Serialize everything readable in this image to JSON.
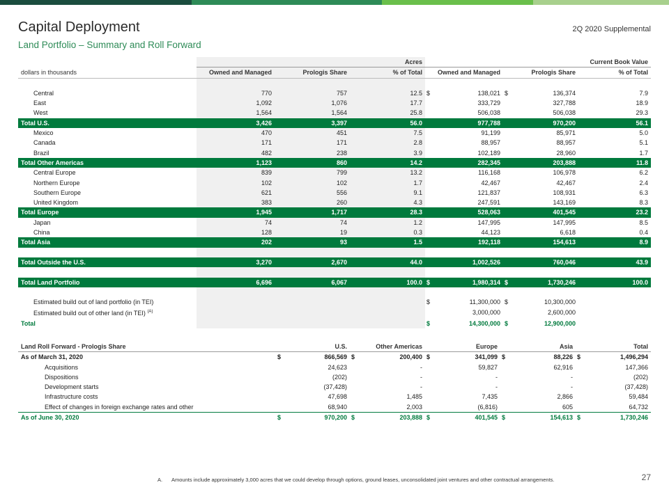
{
  "header": {
    "title": "Capital Deployment",
    "subtitle": "Land Portfolio – Summary and Roll Forward",
    "supplemental": "2Q 2020 Supplemental"
  },
  "colors": {
    "accent_green": "#007a3d",
    "topbar": [
      "#1b4d3e",
      "#2e8b57",
      "#6abf4b",
      "#a8d08d"
    ]
  },
  "summary": {
    "group_headers": {
      "acres": "Acres",
      "book_value": "Current Book Value"
    },
    "columns": [
      "dollars in thousands",
      "Owned and Managed",
      "Prologis Share",
      "% of Total",
      "Owned and Managed",
      "Prologis Share",
      "% of Total"
    ],
    "rows": [
      {
        "label": "Central",
        "type": "item",
        "ac_om": "770",
        "ac_ps": "757",
        "ac_pct": "12.5",
        "d1": "$",
        "bv_om": "138,021",
        "d2": "$",
        "bv_ps": "136,374",
        "bv_pct": "7.9"
      },
      {
        "label": "East",
        "type": "item",
        "ac_om": "1,092",
        "ac_ps": "1,076",
        "ac_pct": "17.7",
        "d1": "",
        "bv_om": "333,729",
        "d2": "",
        "bv_ps": "327,788",
        "bv_pct": "18.9"
      },
      {
        "label": "West",
        "type": "item",
        "ac_om": "1,564",
        "ac_ps": "1,564",
        "ac_pct": "25.8",
        "d1": "",
        "bv_om": "506,038",
        "d2": "",
        "bv_ps": "506,038",
        "bv_pct": "29.3"
      },
      {
        "label": "Total U.S.",
        "type": "total",
        "ac_om": "3,426",
        "ac_ps": "3,397",
        "ac_pct": "56.0",
        "d1": "",
        "bv_om": "977,788",
        "d2": "",
        "bv_ps": "970,200",
        "bv_pct": "56.1"
      },
      {
        "label": "Mexico",
        "type": "item",
        "ac_om": "470",
        "ac_ps": "451",
        "ac_pct": "7.5",
        "d1": "",
        "bv_om": "91,199",
        "d2": "",
        "bv_ps": "85,971",
        "bv_pct": "5.0"
      },
      {
        "label": "Canada",
        "type": "item",
        "ac_om": "171",
        "ac_ps": "171",
        "ac_pct": "2.8",
        "d1": "",
        "bv_om": "88,957",
        "d2": "",
        "bv_ps": "88,957",
        "bv_pct": "5.1"
      },
      {
        "label": "Brazil",
        "type": "item",
        "ac_om": "482",
        "ac_ps": "238",
        "ac_pct": "3.9",
        "d1": "",
        "bv_om": "102,189",
        "d2": "",
        "bv_ps": "28,960",
        "bv_pct": "1.7"
      },
      {
        "label": "Total Other Americas",
        "type": "total",
        "ac_om": "1,123",
        "ac_ps": "860",
        "ac_pct": "14.2",
        "d1": "",
        "bv_om": "282,345",
        "d2": "",
        "bv_ps": "203,888",
        "bv_pct": "11.8"
      },
      {
        "label": "Central Europe",
        "type": "item",
        "ac_om": "839",
        "ac_ps": "799",
        "ac_pct": "13.2",
        "d1": "",
        "bv_om": "116,168",
        "d2": "",
        "bv_ps": "106,978",
        "bv_pct": "6.2"
      },
      {
        "label": "Northern Europe",
        "type": "item",
        "ac_om": "102",
        "ac_ps": "102",
        "ac_pct": "1.7",
        "d1": "",
        "bv_om": "42,467",
        "d2": "",
        "bv_ps": "42,467",
        "bv_pct": "2.4"
      },
      {
        "label": "Southern Europe",
        "type": "item",
        "ac_om": "621",
        "ac_ps": "556",
        "ac_pct": "9.1",
        "d1": "",
        "bv_om": "121,837",
        "d2": "",
        "bv_ps": "108,931",
        "bv_pct": "6.3"
      },
      {
        "label": "United Kingdom",
        "type": "item",
        "ac_om": "383",
        "ac_ps": "260",
        "ac_pct": "4.3",
        "d1": "",
        "bv_om": "247,591",
        "d2": "",
        "bv_ps": "143,169",
        "bv_pct": "8.3"
      },
      {
        "label": "Total Europe",
        "type": "total",
        "ac_om": "1,945",
        "ac_ps": "1,717",
        "ac_pct": "28.3",
        "d1": "",
        "bv_om": "528,063",
        "d2": "",
        "bv_ps": "401,545",
        "bv_pct": "23.2"
      },
      {
        "label": "Japan",
        "type": "item",
        "ac_om": "74",
        "ac_ps": "74",
        "ac_pct": "1.2",
        "d1": "",
        "bv_om": "147,995",
        "d2": "",
        "bv_ps": "147,995",
        "bv_pct": "8.5"
      },
      {
        "label": "China",
        "type": "item",
        "ac_om": "128",
        "ac_ps": "19",
        "ac_pct": "0.3",
        "d1": "",
        "bv_om": "44,123",
        "d2": "",
        "bv_ps": "6,618",
        "bv_pct": "0.4"
      },
      {
        "label": "Total Asia",
        "type": "total",
        "ac_om": "202",
        "ac_ps": "93",
        "ac_pct": "1.5",
        "d1": "",
        "bv_om": "192,118",
        "d2": "",
        "bv_ps": "154,613",
        "bv_pct": "8.9"
      },
      {
        "label": "",
        "type": "spacer"
      },
      {
        "label": "Total Outside the U.S.",
        "type": "total",
        "ac_om": "3,270",
        "ac_ps": "2,670",
        "ac_pct": "44.0",
        "d1": "",
        "bv_om": "1,002,526",
        "d2": "",
        "bv_ps": "760,046",
        "bv_pct": "43.9"
      },
      {
        "label": "",
        "type": "spacer"
      },
      {
        "label": "Total Land Portfolio",
        "type": "total",
        "ac_om": "6,696",
        "ac_ps": "6,067",
        "ac_pct": "100.0",
        "d1": "$",
        "bv_om": "1,980,314",
        "d2": "$",
        "bv_ps": "1,730,246",
        "bv_pct": "100.0"
      },
      {
        "label": "",
        "type": "spacer"
      },
      {
        "label": "Estimated build out of land portfolio (in TEI)",
        "type": "item",
        "sup": "",
        "ac_om": "",
        "ac_ps": "",
        "ac_pct": "",
        "d1": "$",
        "bv_om": "11,300,000",
        "d2": "$",
        "bv_ps": "10,300,000",
        "bv_pct": ""
      },
      {
        "label": "Estimated build out of other land (in TEI)",
        "type": "item",
        "sup": "(A)",
        "ac_om": "",
        "ac_ps": "",
        "ac_pct": "",
        "d1": "",
        "bv_om": "3,000,000",
        "d2": "",
        "bv_ps": "2,600,000",
        "bv_pct": ""
      },
      {
        "label": "Total",
        "type": "gtotal",
        "ac_om": "",
        "ac_ps": "",
        "ac_pct": "",
        "d1": "$",
        "bv_om": "14,300,000",
        "d2": "$",
        "bv_ps": "12,900,000",
        "bv_pct": ""
      }
    ]
  },
  "roll_forward": {
    "columns": [
      "Land Roll Forward - Prologis Share",
      "U.S.",
      "Other Americas",
      "Europe",
      "Asia",
      "Total"
    ],
    "rows": [
      {
        "label": "As of March 31, 2020",
        "type": "bold",
        "cells": [
          [
            "$",
            "866,569"
          ],
          [
            "$",
            "200,400"
          ],
          [
            "$",
            "341,099"
          ],
          [
            "$",
            "88,226"
          ],
          [
            "$",
            "1,496,294"
          ]
        ]
      },
      {
        "label": "Acquisitions",
        "type": "item",
        "cells": [
          [
            "",
            "24,623"
          ],
          [
            "",
            "-"
          ],
          [
            "",
            "59,827"
          ],
          [
            "",
            "62,916"
          ],
          [
            "",
            "147,366"
          ]
        ]
      },
      {
        "label": "Dispositions",
        "type": "item",
        "cells": [
          [
            "",
            "(202)"
          ],
          [
            "",
            "-"
          ],
          [
            "",
            "-"
          ],
          [
            "",
            "-"
          ],
          [
            "",
            "(202)"
          ]
        ]
      },
      {
        "label": "Development starts",
        "type": "item",
        "cells": [
          [
            "",
            "(37,428)"
          ],
          [
            "",
            "-"
          ],
          [
            "",
            "-"
          ],
          [
            "",
            "-"
          ],
          [
            "",
            "(37,428)"
          ]
        ]
      },
      {
        "label": "Infrastructure costs",
        "type": "item",
        "cells": [
          [
            "",
            "47,698"
          ],
          [
            "",
            "1,485"
          ],
          [
            "",
            "7,435"
          ],
          [
            "",
            "2,866"
          ],
          [
            "",
            "59,484"
          ]
        ]
      },
      {
        "label": "Effect of changes in foreign exchange rates and other",
        "type": "item",
        "cells": [
          [
            "",
            "68,940"
          ],
          [
            "",
            "2,003"
          ],
          [
            "",
            "(6,816)"
          ],
          [
            "",
            "605"
          ],
          [
            "",
            "64,732"
          ]
        ]
      },
      {
        "label": "As of June 30, 2020",
        "type": "end",
        "cells": [
          [
            "$",
            "970,200"
          ],
          [
            "$",
            "203,888"
          ],
          [
            "$",
            "401,545"
          ],
          [
            "$",
            "154,613"
          ],
          [
            "$",
            "1,730,246"
          ]
        ]
      }
    ]
  },
  "footnote": {
    "marker": "A.",
    "text": "Amounts include approximately 3,000 acres that we could develop through options, ground leases, unconsolidated joint ventures and other contractual arrangements."
  },
  "page_number": "27"
}
